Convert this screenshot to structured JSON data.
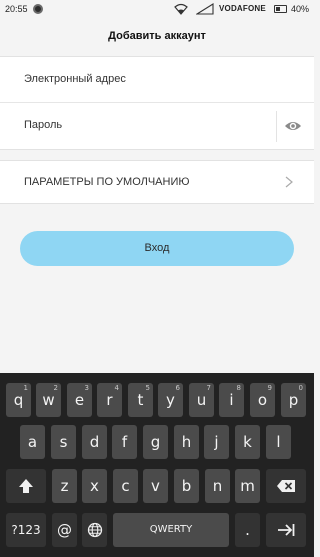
{
  "status_bar": {
    "time": "20:55",
    "carrier": "VODAFONE",
    "battery": "40%"
  },
  "header": {
    "title": "Добавить аккаунт"
  },
  "form": {
    "email_label": "Электронный адрес",
    "password_label": "Пароль"
  },
  "defaults": {
    "label": "ПАРАМЕТРЫ ПО УМОЛЧАНИЮ"
  },
  "login_button": {
    "label": "Вход"
  },
  "keyboard": {
    "row1": [
      {
        "key": "q",
        "hint": "1"
      },
      {
        "key": "w",
        "hint": "2"
      },
      {
        "key": "e",
        "hint": "3"
      },
      {
        "key": "r",
        "hint": "4"
      },
      {
        "key": "t",
        "hint": "5"
      },
      {
        "key": "y",
        "hint": "6"
      },
      {
        "key": "u",
        "hint": "7"
      },
      {
        "key": "i",
        "hint": "8"
      },
      {
        "key": "o",
        "hint": "9"
      },
      {
        "key": "p",
        "hint": "0"
      }
    ],
    "row2": [
      "a",
      "s",
      "d",
      "f",
      "g",
      "h",
      "j",
      "k",
      "l"
    ],
    "row3": [
      "z",
      "x",
      "c",
      "v",
      "b",
      "n",
      "m"
    ],
    "numbers_key": "?123",
    "at_key": "@",
    "space_label": "QWERTY",
    "period_key": "."
  },
  "icons": {
    "eye": "eye-icon",
    "chevron": "chevron-right-icon",
    "shift": "shift-icon",
    "backspace": "backspace-icon",
    "globe": "globe-icon",
    "enter": "next-arrow-icon"
  }
}
